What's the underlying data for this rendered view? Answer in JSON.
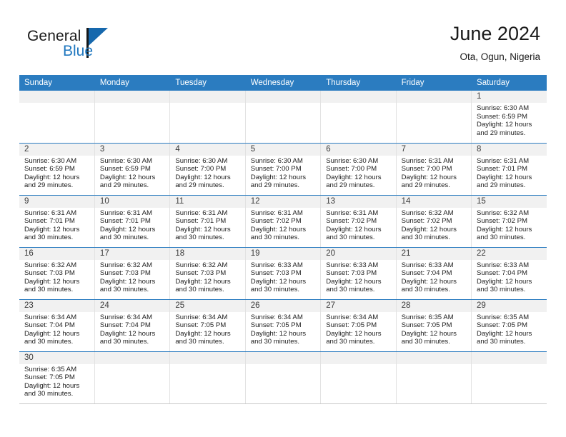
{
  "brand": {
    "name_part1": "General",
    "name_part2": "Blue"
  },
  "header": {
    "title": "June 2024",
    "location": "Ota, Ogun, Nigeria"
  },
  "weekday_headers": [
    "Sunday",
    "Monday",
    "Tuesday",
    "Wednesday",
    "Thursday",
    "Friday",
    "Saturday"
  ],
  "colors": {
    "header_blue": "#2b7cc0",
    "brand_blue": "#1f77bf",
    "daynum_gray": "#f1f1f1"
  },
  "weeks": [
    [
      {
        "day": "",
        "lines": []
      },
      {
        "day": "",
        "lines": []
      },
      {
        "day": "",
        "lines": []
      },
      {
        "day": "",
        "lines": []
      },
      {
        "day": "",
        "lines": []
      },
      {
        "day": "",
        "lines": []
      },
      {
        "day": "1",
        "lines": [
          "Sunrise: 6:30 AM",
          "Sunset: 6:59 PM",
          "Daylight: 12 hours",
          "and 29 minutes."
        ]
      }
    ],
    [
      {
        "day": "2",
        "lines": [
          "Sunrise: 6:30 AM",
          "Sunset: 6:59 PM",
          "Daylight: 12 hours",
          "and 29 minutes."
        ]
      },
      {
        "day": "3",
        "lines": [
          "Sunrise: 6:30 AM",
          "Sunset: 6:59 PM",
          "Daylight: 12 hours",
          "and 29 minutes."
        ]
      },
      {
        "day": "4",
        "lines": [
          "Sunrise: 6:30 AM",
          "Sunset: 7:00 PM",
          "Daylight: 12 hours",
          "and 29 minutes."
        ]
      },
      {
        "day": "5",
        "lines": [
          "Sunrise: 6:30 AM",
          "Sunset: 7:00 PM",
          "Daylight: 12 hours",
          "and 29 minutes."
        ]
      },
      {
        "day": "6",
        "lines": [
          "Sunrise: 6:30 AM",
          "Sunset: 7:00 PM",
          "Daylight: 12 hours",
          "and 29 minutes."
        ]
      },
      {
        "day": "7",
        "lines": [
          "Sunrise: 6:31 AM",
          "Sunset: 7:00 PM",
          "Daylight: 12 hours",
          "and 29 minutes."
        ]
      },
      {
        "day": "8",
        "lines": [
          "Sunrise: 6:31 AM",
          "Sunset: 7:01 PM",
          "Daylight: 12 hours",
          "and 29 minutes."
        ]
      }
    ],
    [
      {
        "day": "9",
        "lines": [
          "Sunrise: 6:31 AM",
          "Sunset: 7:01 PM",
          "Daylight: 12 hours",
          "and 30 minutes."
        ]
      },
      {
        "day": "10",
        "lines": [
          "Sunrise: 6:31 AM",
          "Sunset: 7:01 PM",
          "Daylight: 12 hours",
          "and 30 minutes."
        ]
      },
      {
        "day": "11",
        "lines": [
          "Sunrise: 6:31 AM",
          "Sunset: 7:01 PM",
          "Daylight: 12 hours",
          "and 30 minutes."
        ]
      },
      {
        "day": "12",
        "lines": [
          "Sunrise: 6:31 AM",
          "Sunset: 7:02 PM",
          "Daylight: 12 hours",
          "and 30 minutes."
        ]
      },
      {
        "day": "13",
        "lines": [
          "Sunrise: 6:31 AM",
          "Sunset: 7:02 PM",
          "Daylight: 12 hours",
          "and 30 minutes."
        ]
      },
      {
        "day": "14",
        "lines": [
          "Sunrise: 6:32 AM",
          "Sunset: 7:02 PM",
          "Daylight: 12 hours",
          "and 30 minutes."
        ]
      },
      {
        "day": "15",
        "lines": [
          "Sunrise: 6:32 AM",
          "Sunset: 7:02 PM",
          "Daylight: 12 hours",
          "and 30 minutes."
        ]
      }
    ],
    [
      {
        "day": "16",
        "lines": [
          "Sunrise: 6:32 AM",
          "Sunset: 7:03 PM",
          "Daylight: 12 hours",
          "and 30 minutes."
        ]
      },
      {
        "day": "17",
        "lines": [
          "Sunrise: 6:32 AM",
          "Sunset: 7:03 PM",
          "Daylight: 12 hours",
          "and 30 minutes."
        ]
      },
      {
        "day": "18",
        "lines": [
          "Sunrise: 6:32 AM",
          "Sunset: 7:03 PM",
          "Daylight: 12 hours",
          "and 30 minutes."
        ]
      },
      {
        "day": "19",
        "lines": [
          "Sunrise: 6:33 AM",
          "Sunset: 7:03 PM",
          "Daylight: 12 hours",
          "and 30 minutes."
        ]
      },
      {
        "day": "20",
        "lines": [
          "Sunrise: 6:33 AM",
          "Sunset: 7:03 PM",
          "Daylight: 12 hours",
          "and 30 minutes."
        ]
      },
      {
        "day": "21",
        "lines": [
          "Sunrise: 6:33 AM",
          "Sunset: 7:04 PM",
          "Daylight: 12 hours",
          "and 30 minutes."
        ]
      },
      {
        "day": "22",
        "lines": [
          "Sunrise: 6:33 AM",
          "Sunset: 7:04 PM",
          "Daylight: 12 hours",
          "and 30 minutes."
        ]
      }
    ],
    [
      {
        "day": "23",
        "lines": [
          "Sunrise: 6:34 AM",
          "Sunset: 7:04 PM",
          "Daylight: 12 hours",
          "and 30 minutes."
        ]
      },
      {
        "day": "24",
        "lines": [
          "Sunrise: 6:34 AM",
          "Sunset: 7:04 PM",
          "Daylight: 12 hours",
          "and 30 minutes."
        ]
      },
      {
        "day": "25",
        "lines": [
          "Sunrise: 6:34 AM",
          "Sunset: 7:05 PM",
          "Daylight: 12 hours",
          "and 30 minutes."
        ]
      },
      {
        "day": "26",
        "lines": [
          "Sunrise: 6:34 AM",
          "Sunset: 7:05 PM",
          "Daylight: 12 hours",
          "and 30 minutes."
        ]
      },
      {
        "day": "27",
        "lines": [
          "Sunrise: 6:34 AM",
          "Sunset: 7:05 PM",
          "Daylight: 12 hours",
          "and 30 minutes."
        ]
      },
      {
        "day": "28",
        "lines": [
          "Sunrise: 6:35 AM",
          "Sunset: 7:05 PM",
          "Daylight: 12 hours",
          "and 30 minutes."
        ]
      },
      {
        "day": "29",
        "lines": [
          "Sunrise: 6:35 AM",
          "Sunset: 7:05 PM",
          "Daylight: 12 hours",
          "and 30 minutes."
        ]
      }
    ],
    [
      {
        "day": "30",
        "lines": [
          "Sunrise: 6:35 AM",
          "Sunset: 7:05 PM",
          "Daylight: 12 hours",
          "and 30 minutes."
        ]
      },
      {
        "day": "",
        "lines": []
      },
      {
        "day": "",
        "lines": []
      },
      {
        "day": "",
        "lines": []
      },
      {
        "day": "",
        "lines": []
      },
      {
        "day": "",
        "lines": []
      },
      {
        "day": "",
        "lines": []
      }
    ]
  ]
}
